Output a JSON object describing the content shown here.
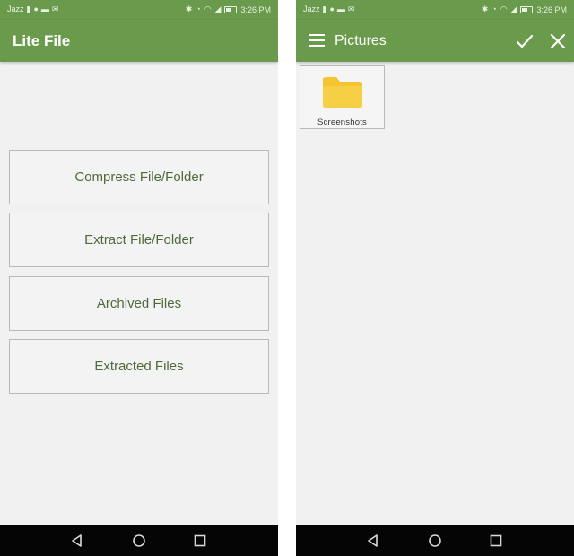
{
  "colors": {
    "toolbar": "#6a9a4b",
    "background": "#f1f1f1",
    "button_text": "#4e6b3c",
    "folder": "#f5c431",
    "nav_bar": "#050505"
  },
  "left_screen": {
    "status_bar": {
      "carrier": "Jazz",
      "time": "3:26 PM",
      "icons": [
        "sim-icon",
        "whatsapp-icon",
        "message-icon",
        "mail-icon",
        "bluetooth-icon",
        "alarm-icon",
        "wifi-icon",
        "signal-icon",
        "battery-icon"
      ]
    },
    "toolbar": {
      "title": "Lite File"
    },
    "buttons": [
      {
        "label": "Compress File/Folder"
      },
      {
        "label": "Extract File/Folder"
      },
      {
        "label": "Archived Files"
      },
      {
        "label": "Extracted Files"
      }
    ],
    "nav_icons": [
      "back-icon",
      "home-icon",
      "recents-icon"
    ]
  },
  "right_screen": {
    "status_bar": {
      "carrier": "Jazz",
      "time": "3:26 PM"
    },
    "toolbar": {
      "title": "Pictures",
      "icons": [
        "menu-icon",
        "check-icon",
        "close-icon"
      ]
    },
    "folders": [
      {
        "name": "Screenshots",
        "icon": "folder-icon"
      }
    ],
    "nav_icons": [
      "back-icon",
      "home-icon",
      "recents-icon"
    ]
  }
}
